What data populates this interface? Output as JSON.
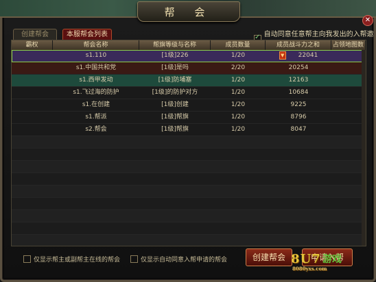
{
  "window": {
    "title": "帮 会",
    "close_icon": "close-icon"
  },
  "tabs": [
    {
      "label": "创建帮会",
      "active": false
    },
    {
      "label": "本服帮会列表",
      "active": true
    }
  ],
  "auto_invite": {
    "label": "自动同意任意帮主向我发出的入帮邀请",
    "checked": true
  },
  "table": {
    "headers": [
      "霸权",
      "帮会名称",
      "帮旗等级与名称",
      "成员数量",
      "成员战斗力之和",
      "占领地图数"
    ],
    "rows": [
      {
        "rank": "",
        "name": "s1.110",
        "flag": "[1级]226",
        "members": "1/20",
        "power": "22041",
        "maps": "",
        "badge": true,
        "style": "sel"
      },
      {
        "rank": "",
        "name": "s1.中国共和党",
        "flag": "[1级]是吗",
        "members": "2/20",
        "power": "20254",
        "maps": "",
        "badge": false,
        "style": "red"
      },
      {
        "rank": "",
        "name": "s1.西甲发动",
        "flag": "[1级]防埔塞",
        "members": "1/20",
        "power": "12163",
        "maps": "",
        "badge": false,
        "style": "teal"
      },
      {
        "rank": "",
        "name": "s1.飞过海的防护",
        "flag": "[1级]的防护对方",
        "members": "1/20",
        "power": "10684",
        "maps": "",
        "badge": false,
        "style": "dark"
      },
      {
        "rank": "",
        "name": "s1.在创建",
        "flag": "[1级]创建",
        "members": "1/20",
        "power": "9225",
        "maps": "",
        "badge": false,
        "style": "dark"
      },
      {
        "rank": "",
        "name": "s1.帮派",
        "flag": "[1级]帮旗",
        "members": "1/20",
        "power": "8796",
        "maps": "",
        "badge": false,
        "style": "dark"
      },
      {
        "rank": "",
        "name": "s2.帮会",
        "flag": "[1级]帮旗",
        "members": "1/20",
        "power": "8047",
        "maps": "",
        "badge": false,
        "style": "dark"
      }
    ],
    "empty_rows": 9
  },
  "filters": [
    {
      "label": "仅显示帮主或副帮主在线的帮会",
      "checked": false
    },
    {
      "label": "仅显示自动同意入帮申请的帮会",
      "checked": false
    }
  ],
  "buttons": {
    "create": "创建帮会",
    "join": "申请入帮"
  },
  "watermark": {
    "main": "8U7",
    "sub": "8080yxs.com",
    "logo": "游戏"
  }
}
